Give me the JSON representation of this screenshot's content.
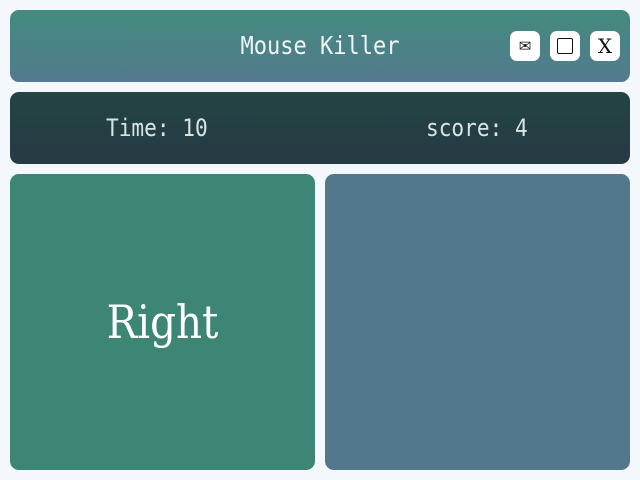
{
  "window": {
    "title": "Mouse Killer",
    "buttons": {
      "mail_icon": "envelope-icon",
      "maximize_icon": "square-icon",
      "close_label": "X"
    }
  },
  "status": {
    "time_label": "Time:",
    "time_value": "10",
    "score_label": "score:",
    "score_value": "4"
  },
  "panes": {
    "left": {
      "label": "Right",
      "color": "#3d8675"
    },
    "right": {
      "label": "",
      "color": "#54788b"
    }
  },
  "colors": {
    "titlebar_top": "#428b7e",
    "titlebar_bottom": "#547a8e",
    "statusbar": "#234442",
    "background": "#f4f7fb"
  }
}
